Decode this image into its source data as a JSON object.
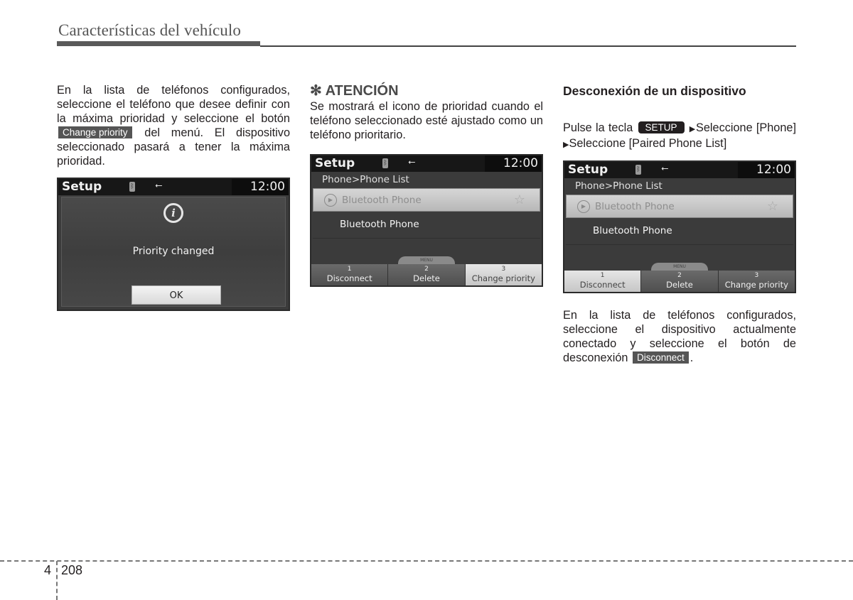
{
  "header": {
    "title": "Características del vehículo"
  },
  "column1": {
    "paragraph_before": "En la lista de teléfonos configurados, seleccione el teléfono que desee definir con la máxima prioridad y seleccione el botón",
    "chip": "Change priority",
    "paragraph_after": "del menú. El dispositivo seleccionado pasará a tener la máxima prioridad.",
    "screen": {
      "title": "Setup",
      "clock": "12:00",
      "status_icons": [
        "bluetooth-icon",
        "usb-icon"
      ],
      "dialog_icon": "info-icon",
      "message": "Priority changed",
      "ok_label": "OK"
    }
  },
  "column2": {
    "attention_symbol": "✻",
    "attention_title": "ATENCIÓN",
    "paragraph": "Se mostrará el icono de prioridad cuando el teléfono seleccionado esté ajustado como un teléfono prioritario.",
    "screen": {
      "title": "Setup",
      "clock": "12:00",
      "breadcrumb": "Phone>Phone List",
      "items": [
        {
          "label": "Bluetooth Phone",
          "selected": true,
          "priority_icon": "star-icon"
        },
        {
          "label": "Bluetooth Phone",
          "selected": false
        }
      ],
      "menu_tab": "MENU",
      "softkeys": [
        {
          "num": "1",
          "label": "Disconnect",
          "active": false
        },
        {
          "num": "2",
          "label": "Delete",
          "active": false
        },
        {
          "num": "3",
          "label": "Change priority",
          "active": true
        }
      ]
    }
  },
  "column3": {
    "section_title": "Desconexión de un dispositivo",
    "instr_prefix": "Pulse la tecla",
    "instr_key": "SETUP",
    "instr_step1": "Seleccione [Phone]",
    "instr_step2": "Seleccione [Paired Phone List]",
    "arrow": "▶",
    "screen": {
      "title": "Setup",
      "clock": "12:00",
      "breadcrumb": "Phone>Phone List",
      "items": [
        {
          "label": "Bluetooth Phone",
          "selected": true,
          "priority_icon": "star-icon"
        },
        {
          "label": "Bluetooth Phone",
          "selected": false
        }
      ],
      "menu_tab": "MENU",
      "softkeys": [
        {
          "num": "1",
          "label": "Disconnect",
          "active": true
        },
        {
          "num": "2",
          "label": "Delete",
          "active": false
        },
        {
          "num": "3",
          "label": "Change priority",
          "active": false
        }
      ]
    },
    "paragraph_before": "En la lista de teléfonos configurados, seleccione el dispositivo actualmente conectado y seleccione el botón de desconexión",
    "chip": "Disconnect",
    "paragraph_after": "."
  },
  "footer": {
    "chapter": "4",
    "page": "208"
  }
}
